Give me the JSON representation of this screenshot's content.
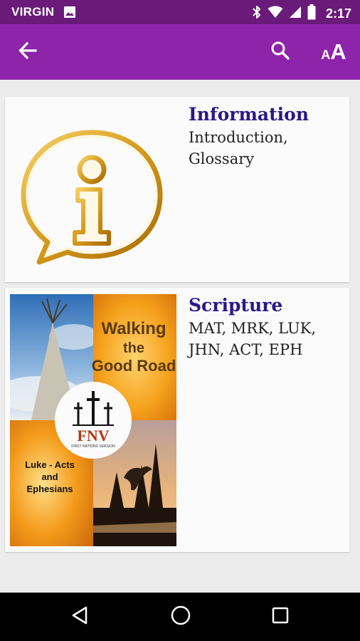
{
  "status_bar": {
    "carrier": "VIRGIN",
    "time": "2:17",
    "icons": [
      "image-icon",
      "bluetooth-icon",
      "wifi-icon",
      "signal-icon",
      "battery-icon"
    ]
  },
  "app_bar": {
    "background": "#8e24aa",
    "back_icon": "arrow-left-icon",
    "search_icon": "search-icon",
    "font_size_icon": "font-size-icon",
    "font_label_small": "A",
    "font_label_big": "A"
  },
  "cards": [
    {
      "title": "Information",
      "description": "Introduction, Glossary",
      "thumbnail_icon": "info-speech-bubble-icon"
    },
    {
      "title": "Scripture",
      "description": "MAT, MRK, LUK, JHN, ACT, EPH",
      "cover": {
        "heading_line1": "Walking",
        "heading_line2": "the",
        "heading_line3": "Good Road",
        "logo_text": "FNV",
        "logo_subtext": "FIRST NATIONS VERSION",
        "books_line1": "Luke - Acts",
        "books_line2": "and",
        "books_line3": "Ephesians"
      }
    }
  ],
  "nav_bar": {
    "icons": [
      "nav-back-icon",
      "nav-home-icon",
      "nav-recents-icon"
    ]
  },
  "colors": {
    "status_bar": "#6a1b7a",
    "app_bar": "#8e24aa",
    "title_text": "#2b1787",
    "background": "#ececec"
  }
}
